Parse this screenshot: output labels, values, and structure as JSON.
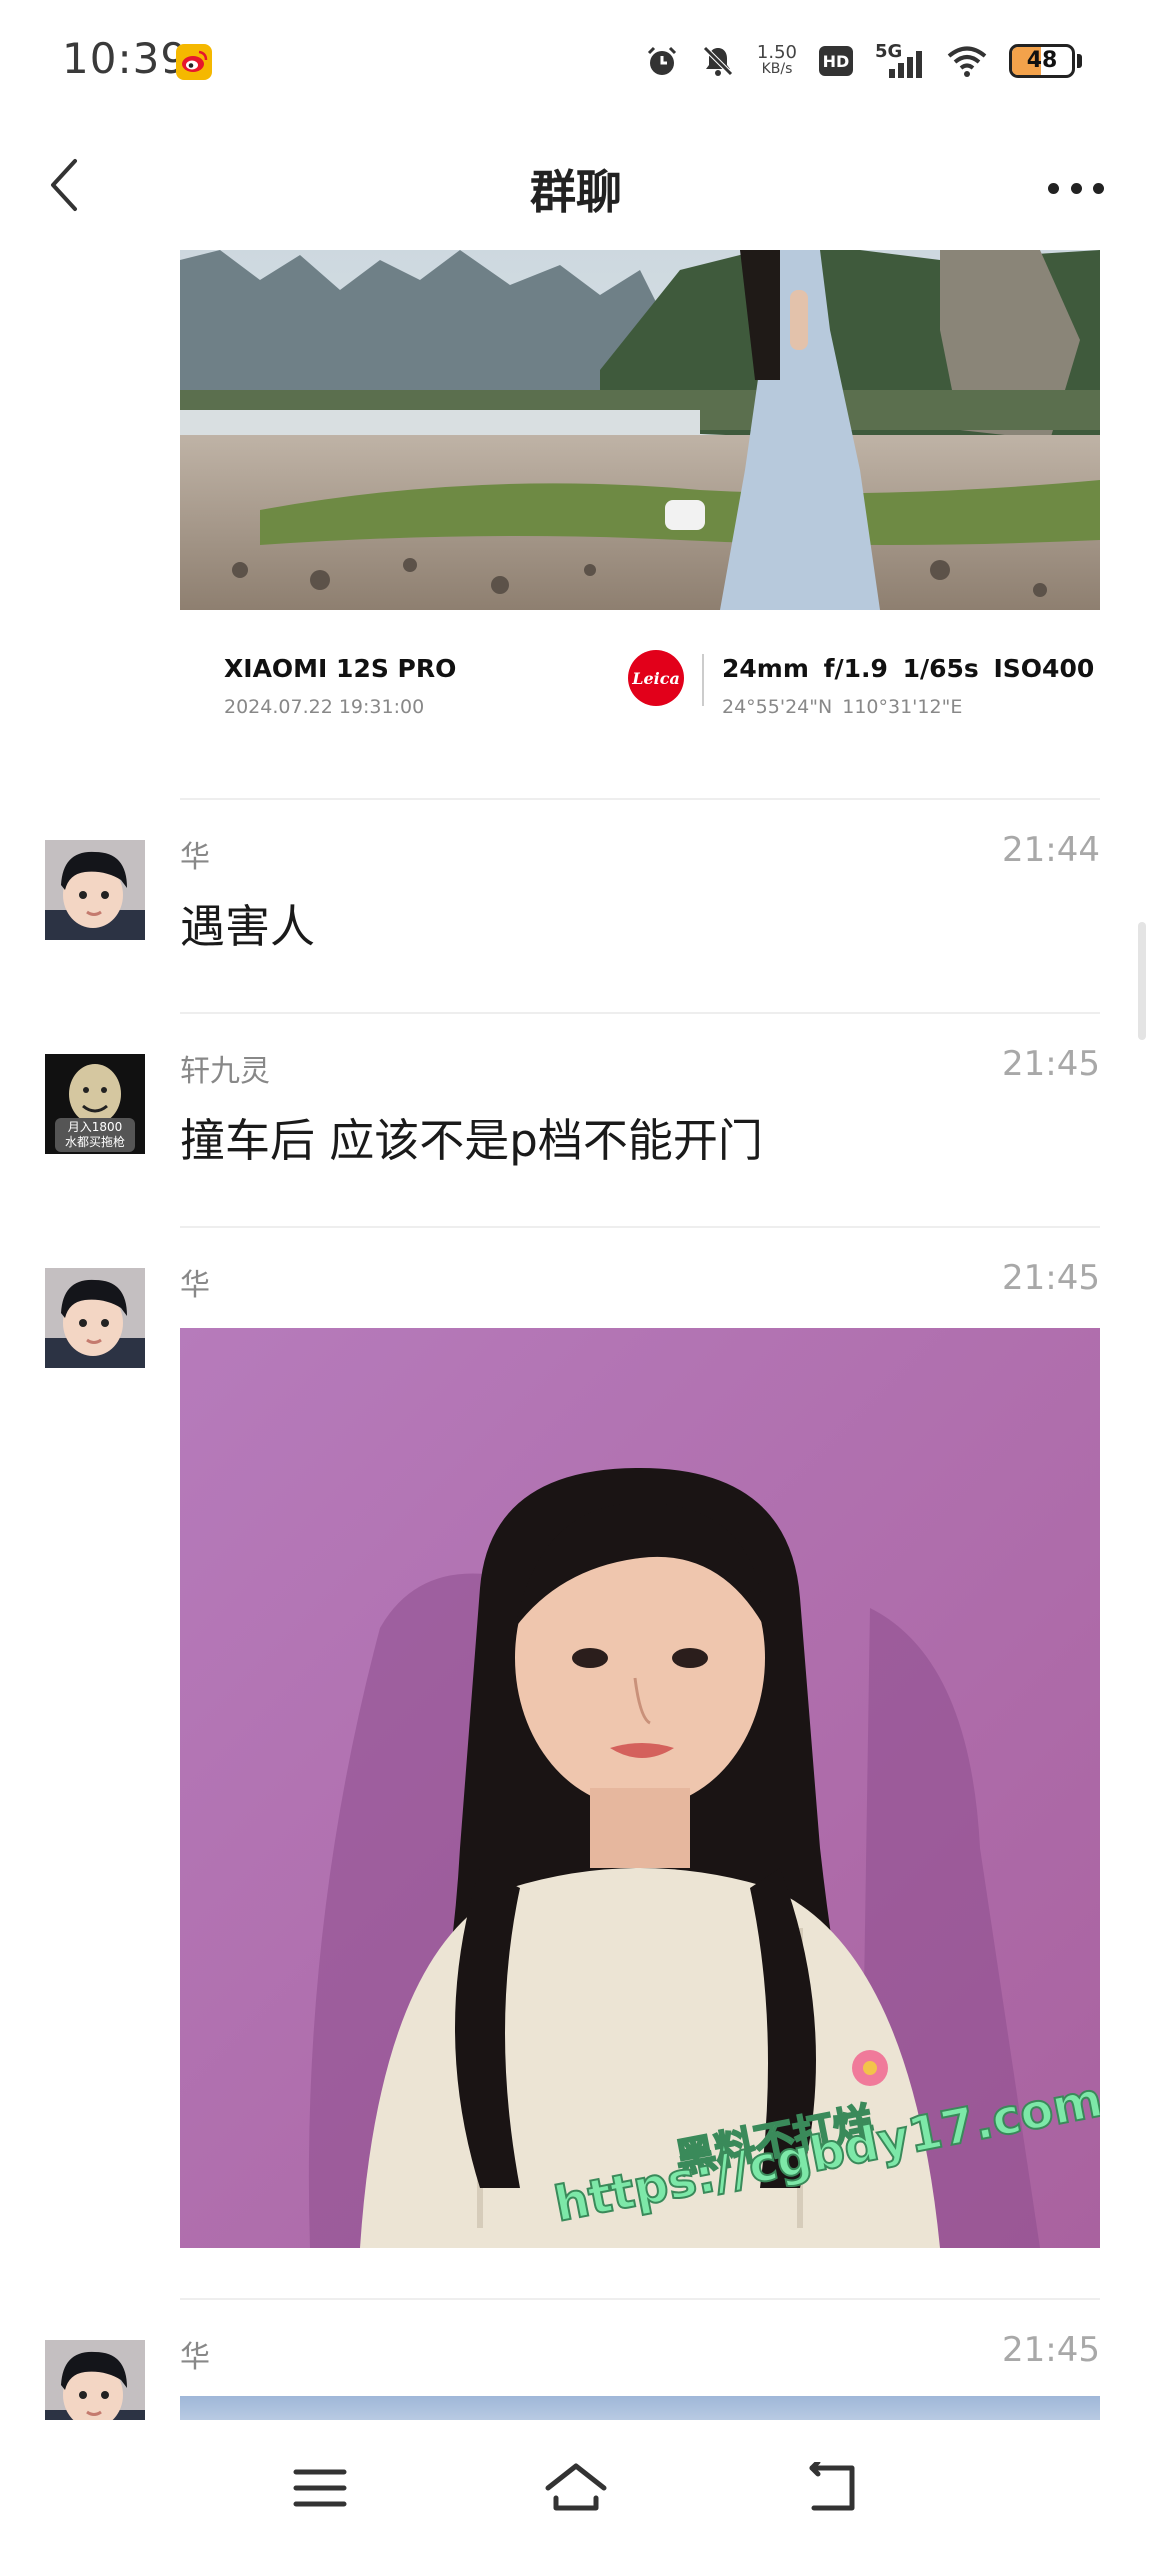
{
  "status_bar": {
    "time": "10:39",
    "app_icon": "weibo-icon",
    "net_speed_value": "1.50",
    "net_speed_unit": "KB/s",
    "hd_label": "HD",
    "network_label": "5G",
    "battery_percent": "48",
    "icons": [
      "alarm-icon",
      "mute-icon",
      "wifi-icon",
      "signal-icon",
      "battery-icon"
    ]
  },
  "header": {
    "title": "群聊",
    "back_icon": "chevron-left-icon",
    "more_icon": "more-dots-icon"
  },
  "messages": [
    {
      "type": "image",
      "description_icon": "landscape-photo",
      "exif": {
        "model": "XIAOMI 12S PRO",
        "date": "2024.07.22  19:31:00",
        "brand": "Leica",
        "params": "24mm  f/1.9  1/65s  ISO400",
        "gps": "24°55'24\"N  110°31'12\"E"
      }
    },
    {
      "type": "text",
      "sender": "华",
      "time": "21:44",
      "text": "遇害人"
    },
    {
      "type": "text",
      "sender": "轩九灵",
      "time": "21:45",
      "text": "撞车后  应该不是p档不能开门",
      "avatar_caption_1": "月入1800",
      "avatar_caption_2": "水都买拖枪"
    },
    {
      "type": "image",
      "sender": "华",
      "time": "21:45"
    },
    {
      "type": "image",
      "sender": "华",
      "time": "21:45"
    }
  ],
  "watermark": {
    "line1": "黑料不打烊",
    "line2": "https://cgbdy17.com"
  },
  "nav_bar": {
    "icons": [
      "menu-icon",
      "home-icon",
      "back-icon"
    ]
  },
  "colors": {
    "leica_red": "#e2001a",
    "battery_fill": "#f3a24b",
    "portrait_background": "#b16fb3"
  }
}
